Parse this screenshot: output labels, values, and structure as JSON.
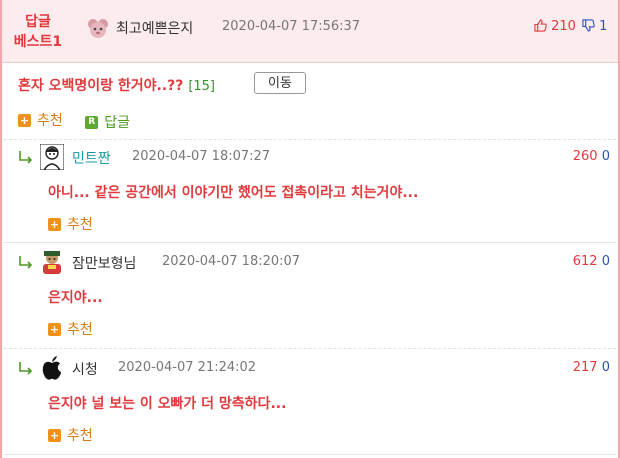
{
  "best": {
    "label_line1": "답글",
    "label_line2": "베스트1",
    "user": "최고예쁜은지",
    "date": "2020-04-07 17:56:37",
    "upvotes": "210",
    "downvotes": "1"
  },
  "post": {
    "title": "혼자 오백명이랑 한거야..??",
    "count": "[15]",
    "move_button": "이동"
  },
  "actions": {
    "recommend_icon": "+",
    "recommend": "추천",
    "reply_icon": "R",
    "reply": "답글"
  },
  "replies": [
    {
      "user": "민트짠",
      "date": "2020-04-07 18:07:27",
      "upvotes": "260",
      "downvotes": "0",
      "text": "아니... 같은 공간에서 이야기만 했어도 접촉이라고 치는거야...",
      "recommend": "추천"
    },
    {
      "user": "잠만보형님",
      "date": "2020-04-07 18:20:07",
      "upvotes": "612",
      "downvotes": "0",
      "text": "은지야...",
      "recommend": "추천"
    },
    {
      "user": "시청",
      "date": "2020-04-07 21:24:02",
      "upvotes": "217",
      "downvotes": "0",
      "text": "은지야 널 보는 이 오빠가 더 망측하다...",
      "recommend": "추천"
    }
  ],
  "colors": {
    "accent_red": "#e03a3e",
    "header_bg": "#fdeced",
    "border_pink": "#f4a7a9",
    "downvote_blue": "#2a52be",
    "recommend_orange": "#f0921a",
    "reply_green": "#5fa832"
  }
}
